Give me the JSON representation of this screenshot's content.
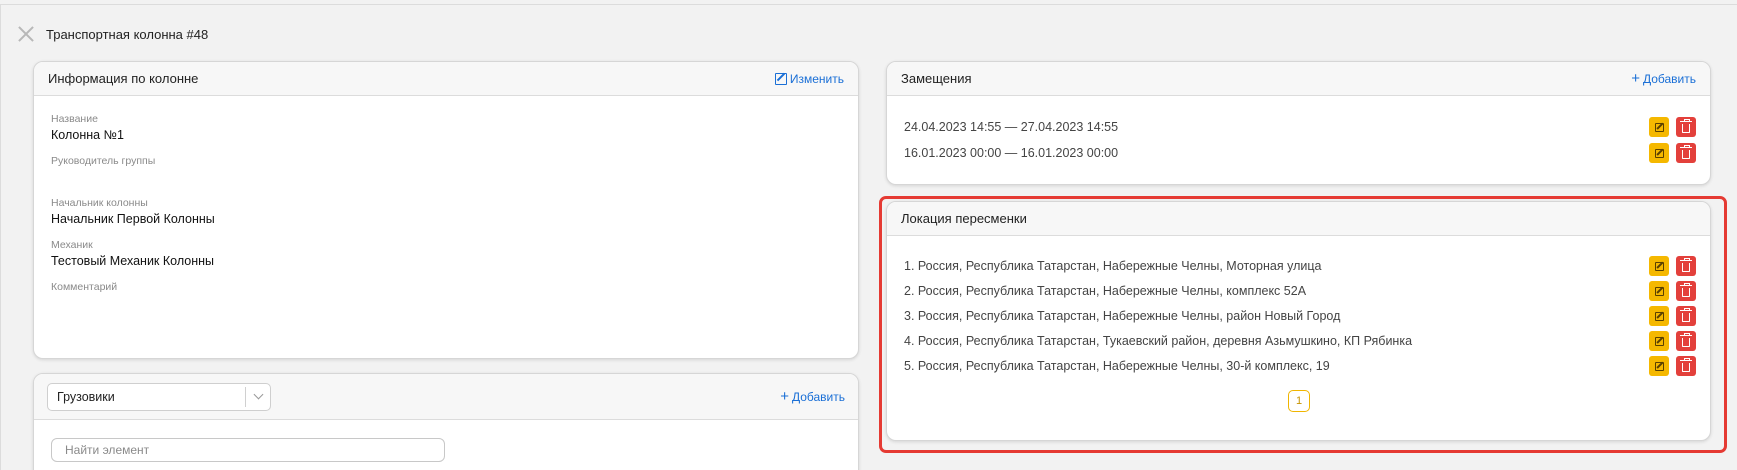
{
  "header": {
    "title": "Транспортная колонна #48"
  },
  "info": {
    "title": "Информация по колонне",
    "edit_label": "Изменить",
    "fields": [
      {
        "label": "Название",
        "value": "Колонна №1"
      },
      {
        "label": "Руководитель группы",
        "value": ""
      },
      {
        "label": "Начальник колонны",
        "value": "Начальник Первой Колонны"
      },
      {
        "label": "Механик",
        "value": "Тестовый Механик Колонны"
      },
      {
        "label": "Комментарий",
        "value": ""
      }
    ]
  },
  "trucks": {
    "select_value": "Грузовики",
    "add_label": "Добавить",
    "search_placeholder": "Найти элемент"
  },
  "substitutions": {
    "title": "Замещения",
    "add_label": "Добавить",
    "items": [
      "24.04.2023 14:55 — 27.04.2023 14:55",
      "16.01.2023 00:00 — 16.01.2023 00:00"
    ]
  },
  "locations": {
    "title": "Локация пересменки",
    "items": [
      "1. Россия, Республика Татарстан, Набережные Челны, Моторная улица",
      "2. Россия, Республика Татарстан, Набережные Челны, комплекс 52А",
      "3. Россия, Республика Татарстан, Набережные Челны, район Новый Город",
      "4. Россия, Республика Татарстан, Тукаевский район, деревня Азьмушкино, КП Рябинка",
      "5. Россия, Республика Татарстан, Набережные Челны, 30-й комплекс, 19"
    ],
    "page": "1"
  },
  "colors": {
    "accent": "#1a6fd6",
    "edit_button": "#f5b800",
    "delete_button": "#e3403b",
    "highlight": "#e53a33"
  }
}
